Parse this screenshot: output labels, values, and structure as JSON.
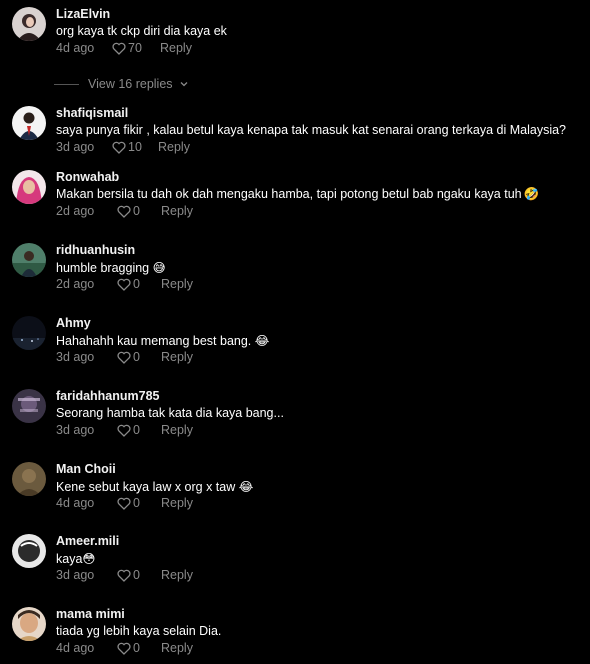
{
  "comments": [
    {
      "username": "LizaElvin",
      "text": "org kaya tk ckp diri dia kaya ek",
      "time": "4d ago",
      "likes": "70",
      "reply": "Reply",
      "view_replies": "View 16 replies"
    },
    {
      "username": "shafiqismail",
      "text": "saya punya fikir , kalau betul kaya kenapa tak masuk kat senarai orang terkaya di Malaysia?",
      "time": "3d ago",
      "likes": "10",
      "reply": "Reply"
    },
    {
      "username": "Ronwahab",
      "text": "Makan bersila tu dah ok dah mengaku hamba, tapi potong betul bab ngaku kaya tuh",
      "emoji": "🤣",
      "time": "2d ago",
      "likes": "0",
      "reply": "Reply"
    },
    {
      "username": "ridhuanhusin",
      "text": "humble bragging",
      "emoji": "😅",
      "time": "2d ago",
      "likes": "0",
      "reply": "Reply"
    },
    {
      "username": "Ahmy",
      "text": "Hahahahh kau memang best bang.",
      "emoji": "😂",
      "time": "3d ago",
      "likes": "0",
      "reply": "Reply"
    },
    {
      "username": "faridahhanum785",
      "text": "Seorang hamba tak kata dia kaya bang...",
      "time": "3d ago",
      "likes": "0",
      "reply": "Reply"
    },
    {
      "username": "Man Choii",
      "text": "Kene sebut kaya law x org x taw",
      "emoji": "😂",
      "time": "4d ago",
      "likes": "0",
      "reply": "Reply"
    },
    {
      "username": "Ameer.mili",
      "text": "kaya",
      "emoji": "😳",
      "time": "3d ago",
      "likes": "0",
      "reply": "Reply"
    },
    {
      "username": "mama mimi",
      "text": "tiada yg lebih kaya selain Dia.",
      "time": "4d ago",
      "likes": "0",
      "reply": "Reply"
    }
  ],
  "colors": {
    "background": "#000000",
    "meta": "#8a8a8a",
    "username": "#f2f2f2"
  }
}
